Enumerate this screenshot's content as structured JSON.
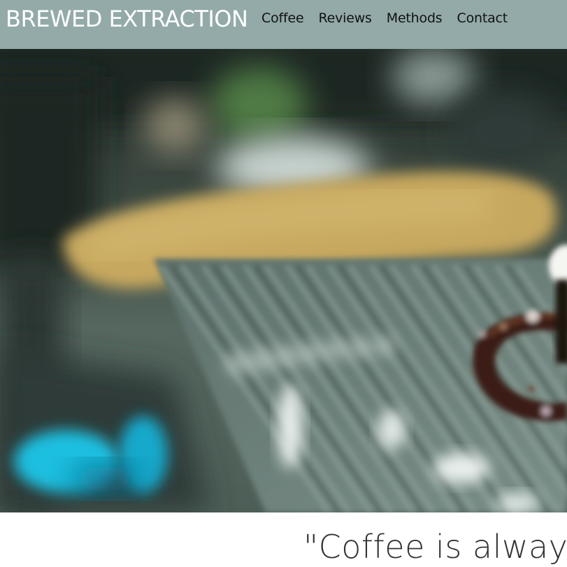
{
  "header": {
    "brand": "BREWED EXTRACTION",
    "background_color": "#93aaa9",
    "nav": [
      {
        "label": "Coffee"
      },
      {
        "label": "Reviews"
      },
      {
        "label": "Methods"
      },
      {
        "label": "Contact"
      }
    ]
  },
  "hero": {
    "image": "blurred espresso machine with coffee cup"
  },
  "quote": {
    "text": "\"Coffee is always"
  }
}
